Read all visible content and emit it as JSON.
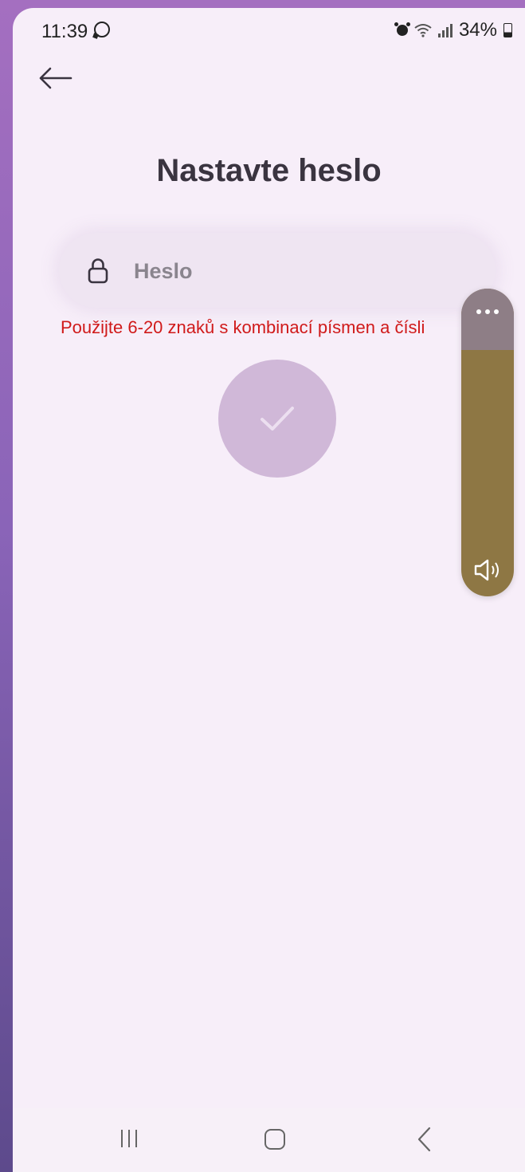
{
  "status_bar": {
    "time": "11:39",
    "battery": "34%",
    "icons": [
      "whatsapp-icon",
      "alarm-icon",
      "wifi-icon",
      "signal-icon",
      "battery-icon"
    ]
  },
  "header": {
    "back_icon": "arrow-left-icon"
  },
  "form": {
    "title": "Nastavte heslo",
    "password_placeholder": "Heslo",
    "password_value": "",
    "lock_icon": "lock-icon",
    "hint": "Použijte 6-20 znaků s kombinací písmen a čísli",
    "submit_icon": "check-icon"
  },
  "colors": {
    "background": "#f7eef9",
    "field_background": "#efe5f2",
    "title": "#3a3440",
    "hint_error": "#d01a1a",
    "submit_disabled": "#d0b8d8",
    "volume_fill": "#8e7744",
    "volume_track": "#8e7e86"
  },
  "volume_panel": {
    "more_icon": "more-horizontal-icon",
    "speaker_icon": "speaker-icon",
    "level_fraction": 0.8
  },
  "nav_bar": {
    "items": [
      "recents-icon",
      "home-icon",
      "back-icon"
    ]
  }
}
